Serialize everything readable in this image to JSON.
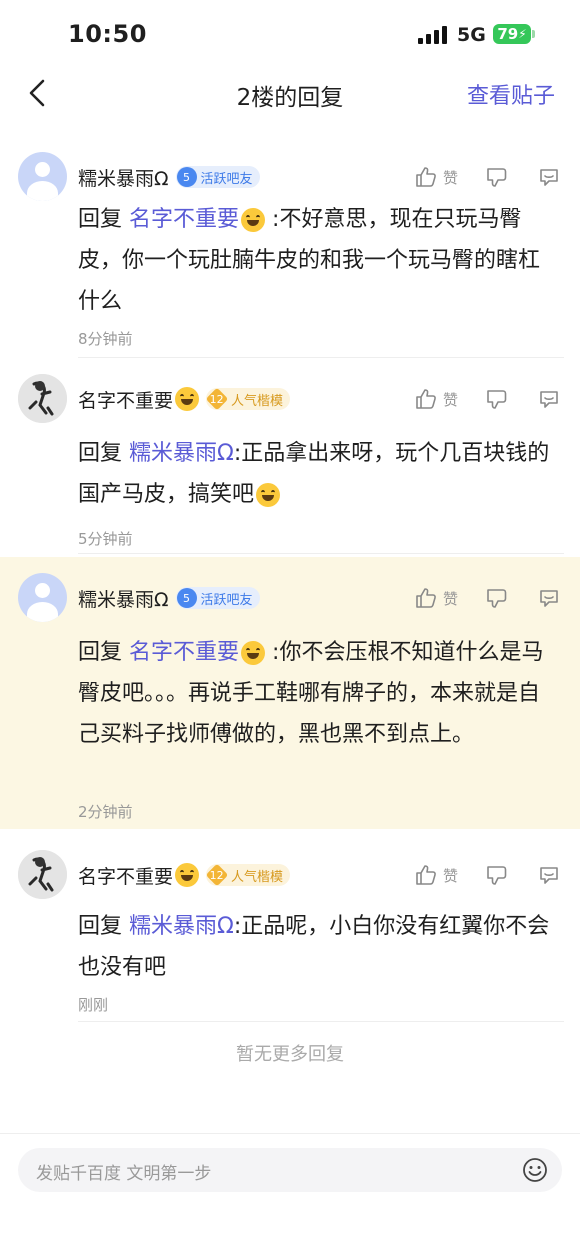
{
  "status": {
    "time": "10:50",
    "network": "5G",
    "battery": "79"
  },
  "nav": {
    "title": "2楼的回复",
    "view_post": "查看贴子"
  },
  "replies": [
    {
      "user": "糯米暴雨Ω",
      "badge_level": "5",
      "badge_label": "活跃吧友",
      "like_label": "赞",
      "prefix": "回复",
      "mention": "名字不重要",
      "text": ":不好意思，现在只玩马臀皮，你一个玩肚腩牛皮的和我一个玩马臀的瞎杠什么",
      "time": "8分钟前"
    },
    {
      "user": "名字不重要",
      "badge_level": "12",
      "badge_label": "人气楷模",
      "like_label": "赞",
      "prefix": "回复",
      "mention": "糯米暴雨Ω",
      "text": ":正品拿出来呀，玩个几百块钱的国产马皮，搞笑吧",
      "time": "5分钟前"
    },
    {
      "user": "糯米暴雨Ω",
      "badge_level": "5",
      "badge_label": "活跃吧友",
      "like_label": "赞",
      "prefix": "回复",
      "mention": "名字不重要",
      "text": ":你不会压根不知道什么是马臀皮吧。。。再说手工鞋哪有牌子的，本来就是自己买料子找师傅做的，黑也黑不到点上。",
      "time": "2分钟前"
    },
    {
      "user": "名字不重要",
      "badge_level": "12",
      "badge_label": "人气楷模",
      "like_label": "赞",
      "prefix": "回复",
      "mention": "糯米暴雨Ω",
      "text": ":正品呢，小白你没有红翼你不会也没有吧",
      "time": "刚刚"
    }
  ],
  "footer": {
    "no_more": "暂无更多回复"
  },
  "input": {
    "placeholder": "发贴千百度 文明第一步"
  }
}
